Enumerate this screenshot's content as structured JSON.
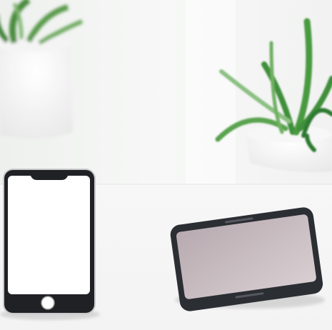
{
  "scene": {
    "description_items": [
      "plant-left",
      "plant-right",
      "smartphone-white-screen",
      "smartphone-tilted-dark-screen"
    ],
    "colors": {
      "wall": "#f2f3f2",
      "table": "#f6f6f6",
      "pot": "#ffffff",
      "leaf": "#3f8f3a",
      "leaf_light": "#8cc083",
      "phone_frame": "#2b2e33",
      "phone_screen_white": "#ffffff",
      "phone_screen_dark": "#c7bbbf"
    }
  }
}
